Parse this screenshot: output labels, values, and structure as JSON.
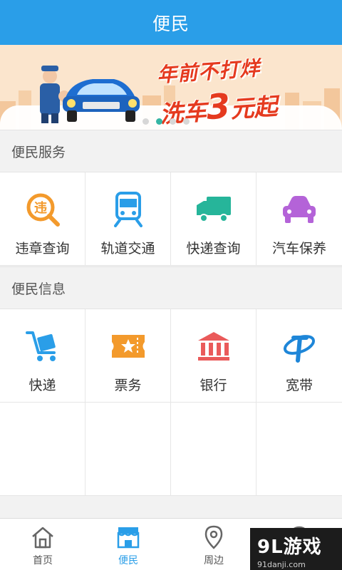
{
  "header": {
    "title": "便民"
  },
  "banner": {
    "line1": "年前不打烊",
    "line2_pre": "洗车",
    "line2_num": "3",
    "line2_post": "元起",
    "dots": 4,
    "active_dot": 1
  },
  "services": {
    "heading": "便民服务",
    "items": [
      {
        "label": "违章查询",
        "icon": "traffic-violation-icon",
        "color": "#f39a2c"
      },
      {
        "label": "轨道交通",
        "icon": "train-icon",
        "color": "#2a9ee8"
      },
      {
        "label": "快递查询",
        "icon": "truck-icon",
        "color": "#26b59a"
      },
      {
        "label": "汽车保养",
        "icon": "car-icon",
        "color": "#b463d8"
      }
    ]
  },
  "info": {
    "heading": "便民信息",
    "items": [
      {
        "label": "快递",
        "icon": "delivery-cart-icon",
        "color": "#2a9ee8"
      },
      {
        "label": "票务",
        "icon": "ticket-icon",
        "color": "#f39a2c"
      },
      {
        "label": "银行",
        "icon": "bank-icon",
        "color": "#ea5a5a"
      },
      {
        "label": "宽带",
        "icon": "telecom-icon",
        "color": "#1e86d8"
      }
    ]
  },
  "tabs": [
    {
      "label": "首页",
      "icon": "home-icon",
      "active": false
    },
    {
      "label": "便民",
      "icon": "store-icon",
      "active": true
    },
    {
      "label": "周边",
      "icon": "location-pin-icon",
      "active": false
    },
    {
      "label": "",
      "icon": "profile-icon",
      "active": false
    }
  ],
  "watermark": {
    "brand": "9L游戏",
    "url": "91danji.com"
  },
  "colors": {
    "primary": "#2a9ee8",
    "promo_red": "#e53a1f",
    "dot_active": "#35b5a4"
  }
}
